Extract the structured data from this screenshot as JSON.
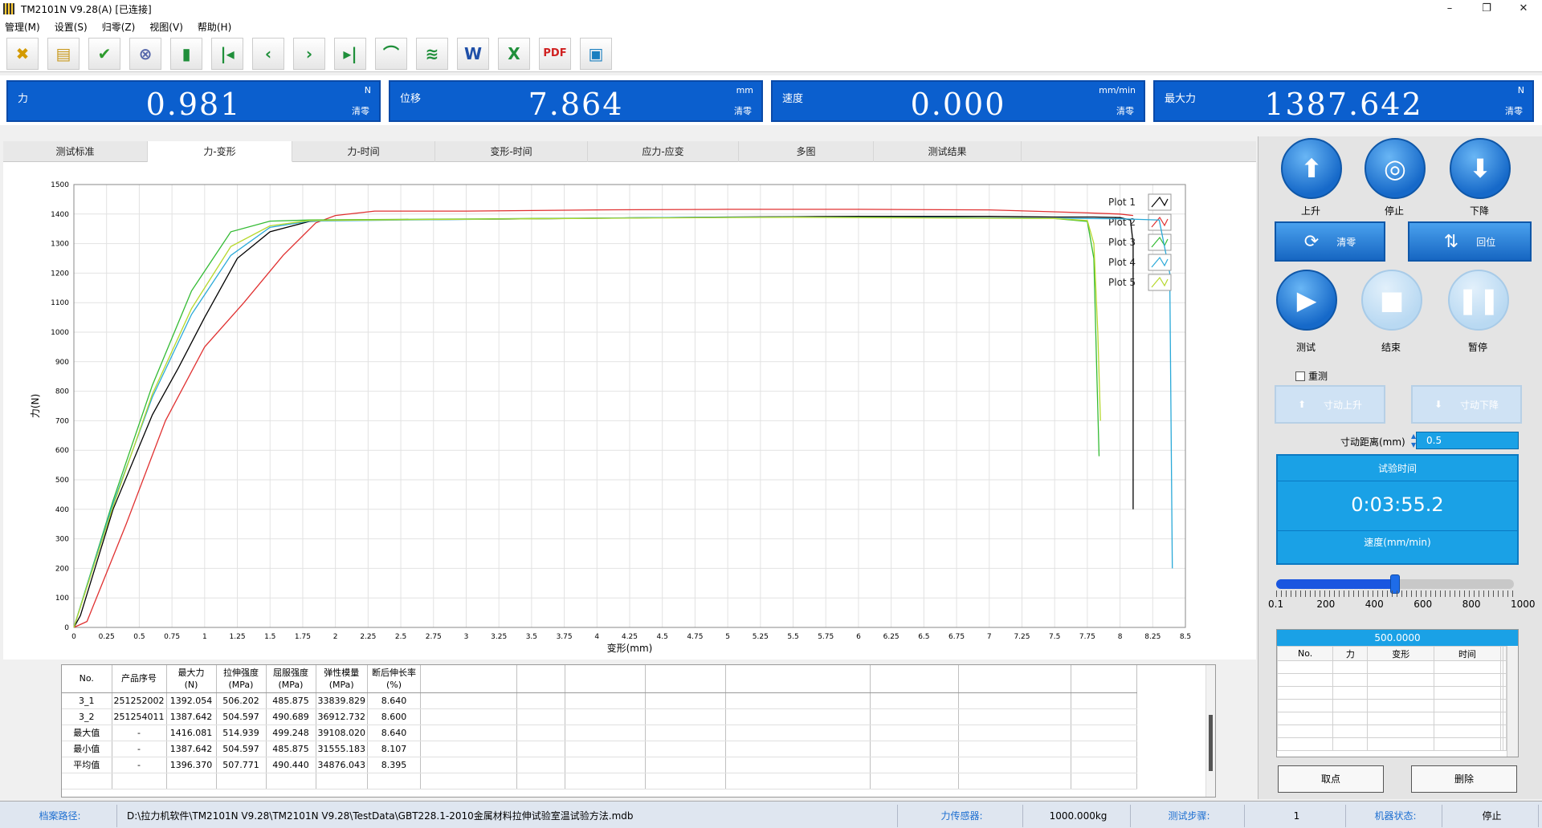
{
  "window": {
    "title": "TM2101N V9.28(A)  [已连接]",
    "min": "–",
    "max": "❐",
    "close": "✕"
  },
  "menu": [
    "管理(M)",
    "设置(S)",
    "归零(Z)",
    "视图(V)",
    "帮助(H)"
  ],
  "toolbar": [
    {
      "name": "settings-tool-icon",
      "glyph": "✖",
      "color": "#d49a00"
    },
    {
      "name": "open-folder-icon",
      "glyph": "▤",
      "color": "#c99a1e"
    },
    {
      "name": "check-report-icon",
      "glyph": "✔",
      "color": "#2d9b2d"
    },
    {
      "name": "delete-record-icon",
      "glyph": "⊗",
      "color": "#5566aa"
    },
    {
      "name": "trash-icon",
      "glyph": "▮",
      "color": "#1f8f3a"
    },
    {
      "name": "first-icon",
      "glyph": "|◂",
      "color": "#1f8f3a"
    },
    {
      "name": "previous-icon",
      "glyph": "‹",
      "color": "#1f8f3a"
    },
    {
      "name": "next-icon",
      "glyph": "›",
      "color": "#1f8f3a"
    },
    {
      "name": "last-icon",
      "glyph": "▸|",
      "color": "#1f8f3a"
    },
    {
      "name": "curve-icon",
      "glyph": "⌒",
      "color": "#1f8f3a"
    },
    {
      "name": "multi-curve-icon",
      "glyph": "≋",
      "color": "#1f8f3a"
    },
    {
      "name": "word-export-icon",
      "glyph": "W",
      "color": "#1f4fa8"
    },
    {
      "name": "excel-export-icon",
      "glyph": "X",
      "color": "#1f8f3a"
    },
    {
      "name": "pdf-export-icon",
      "glyph": "PDF",
      "color": "#d02020"
    },
    {
      "name": "monitor-icon",
      "glyph": "▣",
      "color": "#1a7fc0"
    }
  ],
  "readouts": [
    {
      "label": "力",
      "unit": "N",
      "value": "0.981",
      "zero": "清零"
    },
    {
      "label": "位移",
      "unit": "mm",
      "value": "7.864",
      "zero": "清零"
    },
    {
      "label": "速度",
      "unit": "mm/min",
      "value": "0.000",
      "zero": "清零"
    },
    {
      "label": "最大力",
      "unit": "N",
      "value": "1387.642",
      "zero": "清零"
    }
  ],
  "tabs": [
    {
      "label": "测试标准",
      "active": false
    },
    {
      "label": "力-变形",
      "active": true
    },
    {
      "label": "力-时间",
      "active": false
    },
    {
      "label": "变形-时间",
      "active": false
    },
    {
      "label": "应力-应变",
      "active": false
    },
    {
      "label": "多图",
      "active": false
    },
    {
      "label": "测试结果",
      "active": false
    }
  ],
  "chart_data": {
    "type": "line",
    "xlabel": "变形(mm)",
    "ylabel": "力(N)",
    "xlim": [
      0,
      8.5
    ],
    "ylim": [
      0,
      1500
    ],
    "xticks": [
      "0",
      "0.25",
      "0.5",
      "0.75",
      "1",
      "1.25",
      "1.5",
      "1.75",
      "2",
      "2.25",
      "2.5",
      "2.75",
      "3",
      "3.25",
      "3.5",
      "3.75",
      "4",
      "4.25",
      "4.5",
      "4.75",
      "5",
      "5.25",
      "5.5",
      "5.75",
      "6",
      "6.25",
      "6.5",
      "6.75",
      "7",
      "7.25",
      "7.5",
      "7.75",
      "8",
      "8.25",
      "8.5"
    ],
    "yticks": [
      "0",
      "100",
      "200",
      "300",
      "400",
      "500",
      "600",
      "700",
      "800",
      "900",
      "1000",
      "1100",
      "1200",
      "1300",
      "1400",
      "1500"
    ],
    "grid": true,
    "legend": "top-right",
    "series": [
      {
        "name": "Plot 1",
        "color": "#000000",
        "x": [
          0,
          0.05,
          0.3,
          0.6,
          0.8,
          1.0,
          1.25,
          1.5,
          1.8,
          2.0,
          3.0,
          4.0,
          5.0,
          6.0,
          7.0,
          7.5,
          7.8,
          8.0,
          8.08,
          8.1,
          8.1
        ],
        "y": [
          0,
          40,
          400,
          720,
          880,
          1050,
          1250,
          1340,
          1375,
          1380,
          1382,
          1386,
          1390,
          1392,
          1392,
          1390,
          1390,
          1388,
          1380,
          1300,
          400
        ]
      },
      {
        "name": "Plot 2",
        "color": "#e03030",
        "x": [
          0,
          0.1,
          0.4,
          0.7,
          1.0,
          1.3,
          1.6,
          1.85,
          2.0,
          2.3,
          3.0,
          4.0,
          5.0,
          6.0,
          7.0,
          7.7,
          8.0,
          8.1
        ],
        "y": [
          0,
          20,
          350,
          700,
          950,
          1100,
          1260,
          1370,
          1395,
          1410,
          1410,
          1414,
          1416,
          1416,
          1414,
          1405,
          1400,
          1395
        ]
      },
      {
        "name": "Plot 3",
        "color": "#33bb33",
        "x": [
          0,
          0.3,
          0.6,
          0.9,
          1.2,
          1.5,
          1.8,
          2.5,
          3.5,
          4.5,
          5.5,
          6.5,
          7.5,
          7.75,
          7.8,
          7.82,
          7.84
        ],
        "y": [
          0,
          430,
          820,
          1140,
          1340,
          1376,
          1380,
          1382,
          1385,
          1388,
          1390,
          1388,
          1385,
          1375,
          1250,
          900,
          580
        ]
      },
      {
        "name": "Plot 4",
        "color": "#2aa9d8",
        "x": [
          0,
          0.3,
          0.6,
          0.9,
          1.2,
          1.5,
          1.8,
          2.5,
          3.5,
          4.5,
          5.5,
          6.5,
          7.5,
          8.0,
          8.3,
          8.38,
          8.4
        ],
        "y": [
          0,
          420,
          780,
          1060,
          1260,
          1355,
          1376,
          1380,
          1384,
          1388,
          1390,
          1388,
          1386,
          1384,
          1380,
          1200,
          200
        ]
      },
      {
        "name": "Plot 5",
        "color": "#b6d82c",
        "x": [
          0,
          0.3,
          0.6,
          0.9,
          1.2,
          1.5,
          1.8,
          2.5,
          3.5,
          4.5,
          5.5,
          6.5,
          7.5,
          7.75,
          7.8,
          7.83,
          7.85
        ],
        "y": [
          0,
          410,
          790,
          1080,
          1290,
          1360,
          1378,
          1381,
          1384,
          1387,
          1389,
          1387,
          1385,
          1378,
          1300,
          1000,
          700
        ]
      }
    ]
  },
  "results": {
    "columns": [
      {
        "h1": "No.",
        "h2": "",
        "h3": ""
      },
      {
        "h1": "产品序号",
        "h2": "",
        "h3": ""
      },
      {
        "h1": "最大力",
        "h2": "(N)",
        "h3": ""
      },
      {
        "h1": "拉伸强度",
        "h2": "(MPa)",
        "h3": ""
      },
      {
        "h1": "屈服强度",
        "h2": "(MPa)",
        "h3": ""
      },
      {
        "h1": "弹性模量",
        "h2": "(MPa)",
        "h3": ""
      },
      {
        "h1": "断后伸长率",
        "h2": "(%)",
        "h3": ""
      }
    ],
    "rows": [
      [
        "3_1",
        "251252002",
        "1392.054",
        "506.202",
        "485.875",
        "33839.829",
        "8.640"
      ],
      [
        "3_2",
        "251254011",
        "1387.642",
        "504.597",
        "490.689",
        "36912.732",
        "8.600"
      ],
      [
        "最大值",
        "-",
        "1416.081",
        "514.939",
        "499.248",
        "39108.020",
        "8.640"
      ],
      [
        "最小值",
        "-",
        "1387.642",
        "504.597",
        "485.875",
        "31555.183",
        "8.107"
      ],
      [
        "平均值",
        "-",
        "1396.370",
        "507.771",
        "490.440",
        "34876.043",
        "8.395"
      ]
    ]
  },
  "statusbar": {
    "path_label": "档案路径:",
    "path": "D:\\拉力机软件\\TM2101N V9.28\\TM2101N V9.28\\TestData\\GBT228.1-2010金属材料拉伸试验室温试验方法.mdb",
    "sensor_label": "力传感器:",
    "sensor": "1000.000kg",
    "step_label": "测试步骤:",
    "step": "1",
    "state_label": "机器状态:",
    "state": "停止"
  },
  "panel": {
    "up": "上升",
    "stop": "停止",
    "down": "下降",
    "zero": "清零",
    "return": "回位",
    "test": "测试",
    "end": "结束",
    "pause": "暂停",
    "retest": "重测",
    "jog_up": "寸动上升",
    "jog_down": "寸动下降",
    "jog_dist_label": "寸动距离(mm)",
    "jog_dist": "0.5",
    "time_caption": "试验时间",
    "time": "0:03:55.2",
    "speed_caption": "速度(mm/min)",
    "speed_labels": [
      "0.1",
      "200",
      "400",
      "600",
      "800",
      "1000"
    ],
    "speed_fraction": 0.5,
    "points_header": "500.0000",
    "points_cols": [
      "No.",
      "力",
      "变形",
      "时间",
      "",
      ""
    ],
    "take_point": "取点",
    "delete": "删除"
  }
}
